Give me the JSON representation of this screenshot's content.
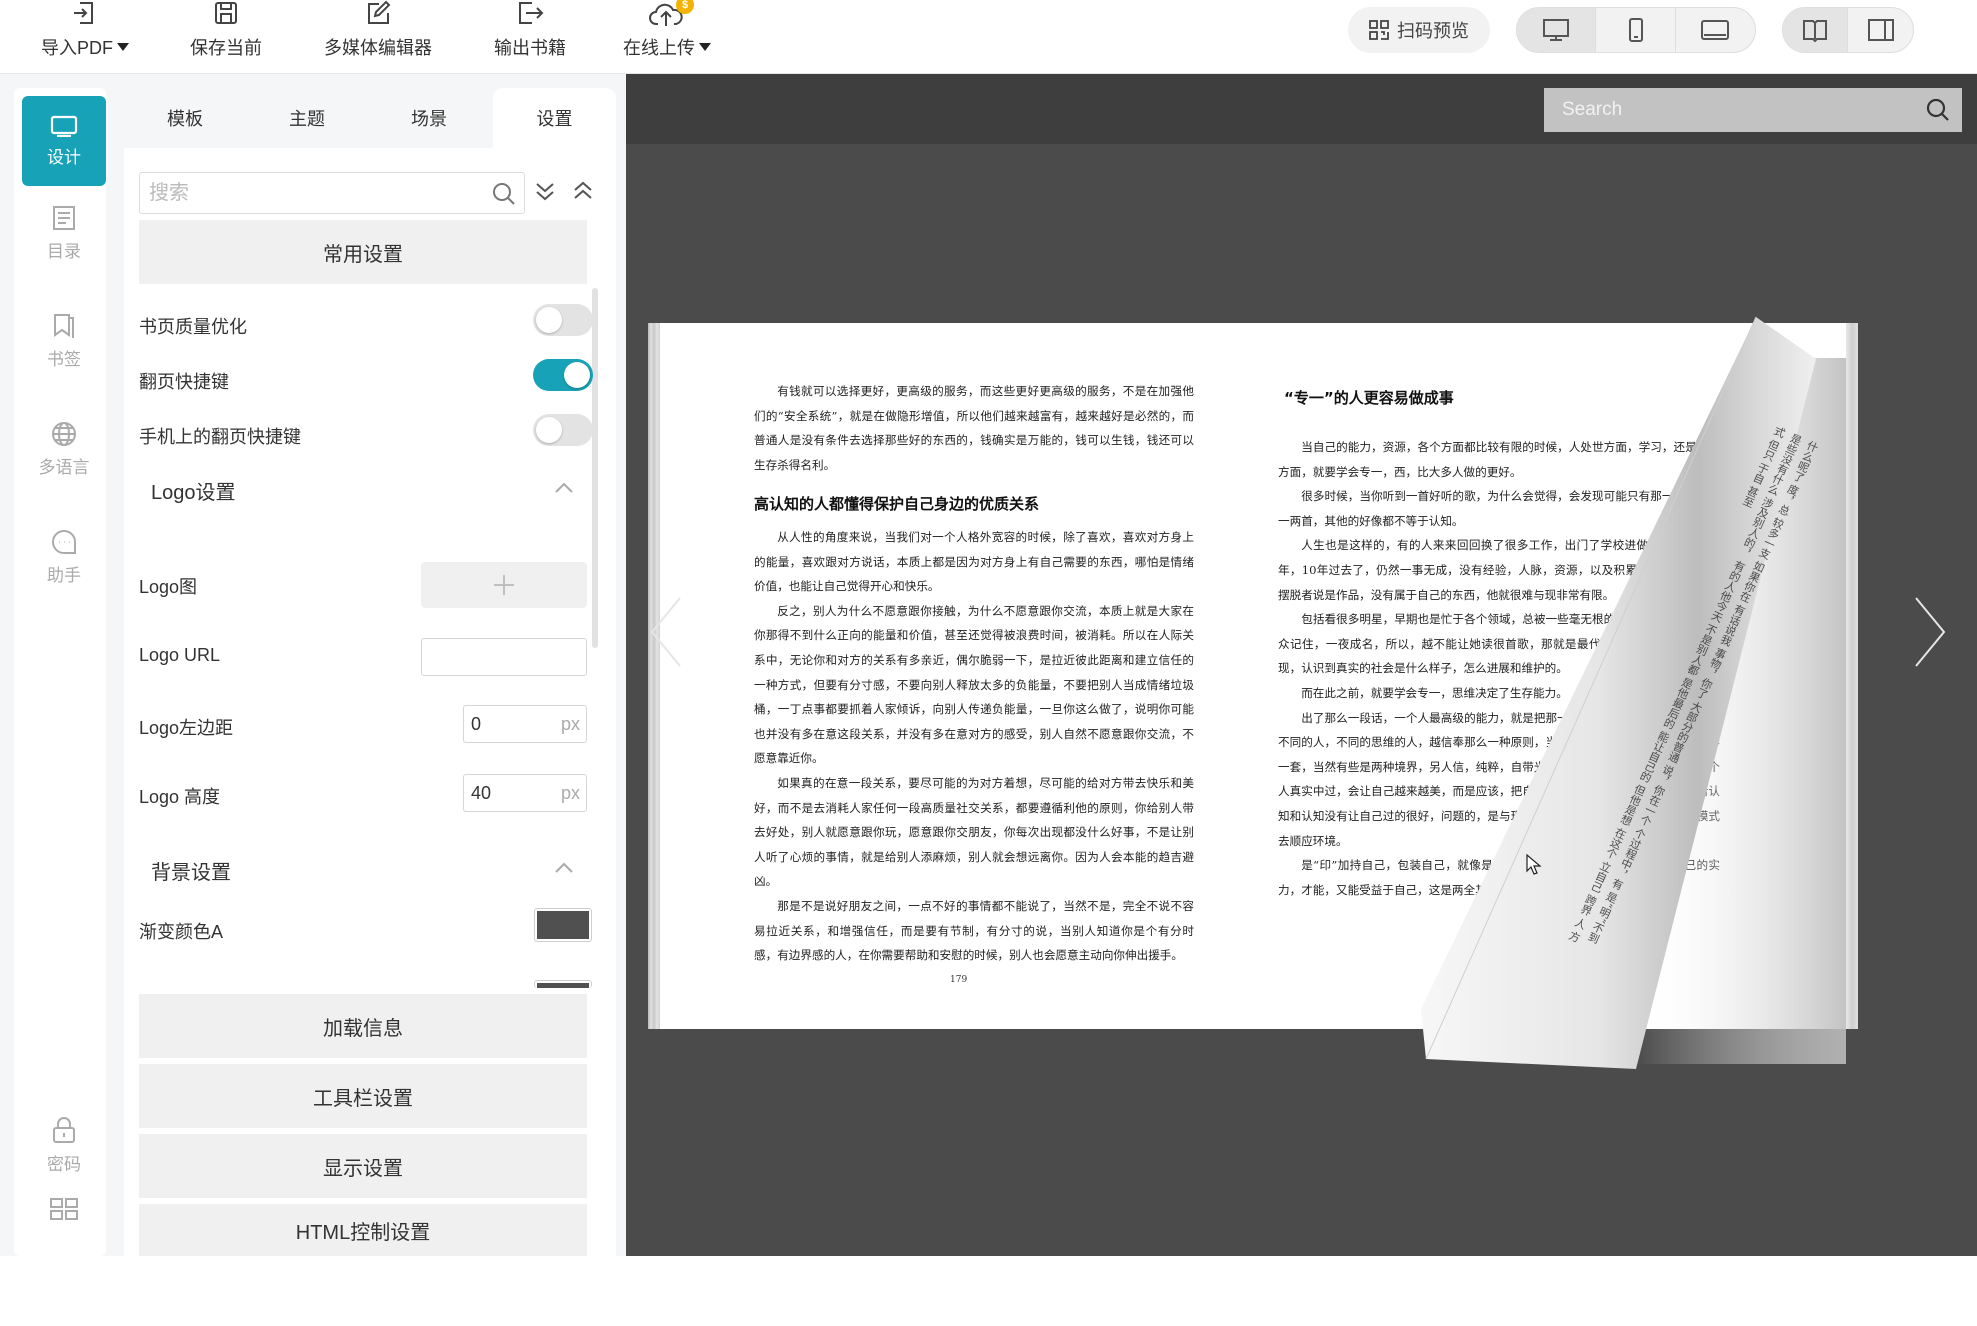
{
  "toolbar": {
    "import_pdf": "导入PDF",
    "save_current": "保存当前",
    "multimedia_editor": "多媒体编辑器",
    "export_book": "输出书籍",
    "upload_online": "在线上传",
    "upload_badge": "$",
    "scan_preview": "扫码预览"
  },
  "leftnav": {
    "items": [
      {
        "label": "设计",
        "icon": "monitor-icon"
      },
      {
        "label": "目录",
        "icon": "contents-icon"
      },
      {
        "label": "书签",
        "icon": "bookmark-icon"
      },
      {
        "label": "多语言",
        "icon": "globe-icon"
      },
      {
        "label": "助手",
        "icon": "chat-icon"
      },
      {
        "label": "密码",
        "icon": "lock-icon"
      },
      {
        "label": "",
        "icon": "grid-icon"
      }
    ]
  },
  "panel": {
    "tabs": [
      "模板",
      "主题",
      "场景",
      "设置"
    ],
    "active_tab": "设置",
    "search_placeholder": "搜索",
    "common_settings": "常用设置",
    "page_quality": "书页质量优化",
    "page_quality_on": false,
    "flip_shortcut": "翻页快捷键",
    "flip_shortcut_on": true,
    "mobile_flip_shortcut": "手机上的翻页快捷键",
    "mobile_flip_shortcut_on": false,
    "logo_section": "Logo设置",
    "logo_image": "Logo图",
    "logo_url": "Logo URL",
    "logo_left": "Logo左边距",
    "logo_left_value": "0",
    "logo_height": "Logo 高度",
    "logo_height_value": "40",
    "unit": "px",
    "background_section": "背景设置",
    "gradient_a": "渐变颜色A",
    "gradient_a_color": "#505050",
    "loading_info": "加载信息",
    "toolbar_settings": "工具栏设置",
    "display_settings": "显示设置",
    "html_control": "HTML控制设置"
  },
  "colors": {
    "accent": "#17a2b8",
    "preview_bg": "#4b4b4b"
  },
  "preview": {
    "search_placeholder": "Search",
    "left_page": {
      "para1": "有钱就可以选择更好，更高级的服务，而这些更好更高级的服务，不是在加强他们的“安全系统”，就是在做隐形增值，所以他们越来越富有，越来越好是必然的，而普通人是没有条件去选择那些好的东西的，钱确实是万能的，钱可以生钱，钱还可以生存杀得名利。",
      "heading": "高认知的人都懂得保护自己身边的优质关系",
      "para2": "从人性的角度来说，当我们对一个人格外宽容的时候，除了喜欢，喜欢对方身上的能量，喜欢跟对方说话，本质上都是因为对方身上有自己需要的东西，哪怕是情绪价值，也能让自己觉得开心和快乐。",
      "para3": "反之，别人为什么不愿意跟你接触，为什么不愿意跟你交流，本质上就是大家在你那得不到什么正向的能量和价值，甚至还觉得被浪费时间，被消耗。所以在人际关系中，无论你和对方的关系有多亲近，偶尔脆弱一下，是拉近彼此距离和建立信任的一种方式，但要有分寸感，不要向别人释放太多的负能量，不要把别人当成情绪垃圾桶，一丁点事都要抓着人家倾诉，向别人传递负能量，一旦你这么做了，说明你可能也并没有多在意这段关系，并没有多在意对方的感受，别人自然不愿意跟你交流，不愿意靠近你。",
      "para4": "如果真的在意一段关系，要尽可能的为对方着想，尽可能的给对方带去快乐和美好，而不是去消耗人家任何一段高质量社交关系，都要遵循利他的原则，你给别人带去好处，别人就愿意跟你玩，愿意跟你交朋友，你每次出现都没什么好事，不是让别人听了心烦的事情，就是给别人添麻烦，别人就会想远离你。因为人会本能的趋吉避凶。",
      "para5": "那是不是说好朋友之间，一点不好的事情都不能说了，当然不是，完全不说不容易拉近关系，和增强信任，而是要有节制，有分寸的说，当别人知道你是个有分时感，有边界感的人，在你需要帮助和安慰的时候，别人也会愿意主动向你伸出援手。",
      "page_number": "179"
    },
    "right_page": {
      "heading": "“专一”的人更容易做成事",
      "para1": "当自己的能力，资源，各个方面都比较有限的时候，人处世方面，学习，还是做事方面，就要学会专一，西，比大多人做的更好。",
      "para2": "很多时候，当你听到一首好听的歌，为什么会觉得，会发现可能只有那一首，或者一两首，其他的好像都不等于认知。",
      "para3": "人生也是这样的，有的人来来回回换了很多工作，出门了学校进做一年，那做两年，10年过去了，仍然一事无成，没有经验，人脉，资源，以及积累，思维上，无法摆脱者说是作品，没有属于自己的东西，他就很难与现非常有限。",
      "para4": "包括看很多明星，早期也是忙于各个领域，总被一些毫无根的就那么一部剧，被大众记住，一夜成名，所以，越不能让她读很首歌，那就是最代表作，有时候你就会发现，认识到真实的社会是什么样子，怎么进展和维护的。",
      "para5": "而在此之前，就要学会专一，思维决定了生存能力。",
      "para6": "出了那么一段话，一个人最高级的能力，就是把那一件事做到极致，这就是专一，不同的人，不同的思维的人，越信奉那么一种原则，当然有些人不信奉这个，而是信奉一套，当然有些是两种境界，另人信，纯粹，自带光芒，然后真正的站在高处，当一个人真实中过，会让自己越来越美，而是应该，把自己原有的思维模式全部打破，重新认知和认知没有让自己过的很好，问题的，是与现实环境的生存规则，把自己的思维模式去顺应环境。",
      "para7": "是“印”加持自己，包装自己，就像是频呢，本质上就是这个意思，然后自己的实力，才能，又能受益于自己，这是两全其美的事。",
      "flip_text": "什么呢了  度，总  较多一支  如果你在  有话说我  事物，你了  大部分的普通  说，你在一个  个过程中，有  是“明”不到  是些没有什么  涉及别人的，  有的人他今天  不是别人都  是他最后的  能让自己的  但他是想  在这个  立自己  跨界  人  方式  但只  于自  甚至"
    }
  }
}
